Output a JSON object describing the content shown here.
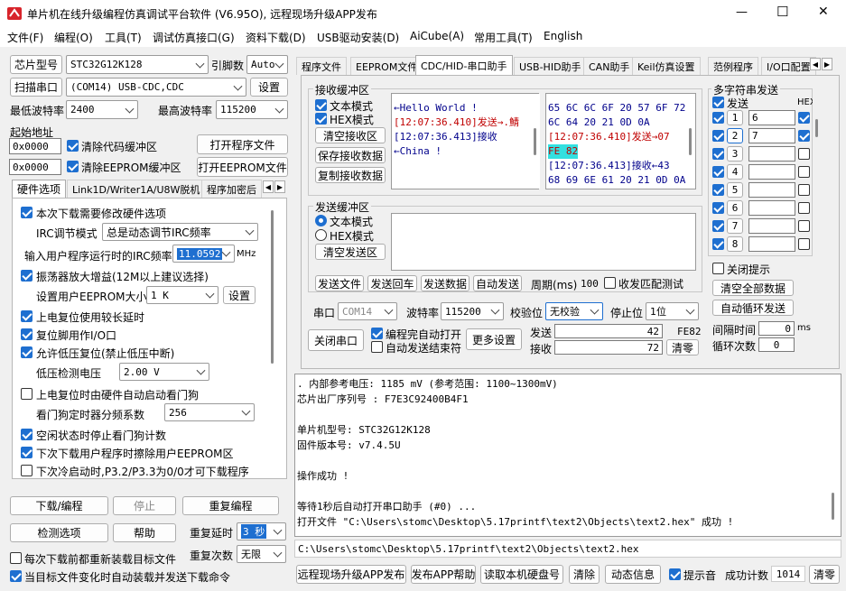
{
  "window": {
    "title": "单片机在线升级编程仿真调试平台软件 (V6.95O), 远程现场升级APP发布",
    "controls": {
      "min": "—",
      "max": "☐",
      "close": "✕"
    }
  },
  "menu": [
    "文件(F)",
    "编程(O)",
    "工具(T)",
    "调试仿真接口(G)",
    "资料下载(D)",
    "USB驱动安装(D)",
    "AiCube(A)",
    "常用工具(T)",
    "English"
  ],
  "left": {
    "chip_label": "芯片型号",
    "chip_value": "STC32G12K128",
    "pin_label": "引脚数",
    "pin_value": "Auto",
    "scan_btn": "扫描串口",
    "port_value": "(COM14) USB-CDC,CDC",
    "settings_btn": "设置",
    "min_baud_label": "最低波特率",
    "min_baud_value": "2400",
    "max_baud_label": "最高波特率",
    "max_baud_value": "115200",
    "start_addr_label": "起始地址",
    "addr1": "0x0000",
    "clear_code_label": "清除代码缓冲区",
    "open_prog_btn": "打开程序文件",
    "addr2": "0x0000",
    "clear_eeprom_label": "清除EEPROM缓冲区",
    "open_eeprom_btn": "打开EEPROM文件",
    "tabs": [
      "硬件选项",
      "Link1D/Writer1A/U8W脱机",
      "程序加密后"
    ],
    "hw": {
      "modify_hw": "本次下载需要修改硬件选项",
      "irc_mode_label": "IRC调节模式",
      "irc_mode_value": "总是动态调节IRC频率",
      "irc_freq_label": "输入用户程序运行时的IRC频率",
      "irc_freq_value": "11.0592",
      "irc_unit": "MHz",
      "osc_gain": "振荡器放大增益(12M以上建议选择)",
      "eeprom_size_label": "设置用户EEPROM大小",
      "eeprom_size_value": "1   K",
      "eeprom_set_btn": "设置",
      "long_reset": "上电复位使用较长延时",
      "reset_pin": "复位脚用作I/O口",
      "lvd_reset": "允许低压复位(禁止低压中断)",
      "lvd_label": "低压检测电压",
      "lvd_value": "2.00 V",
      "wdt_auto": "上电复位时由硬件自动启动看门狗",
      "wdt_div_label": "看门狗定时器分频系数",
      "wdt_div_value": "256",
      "idle_wdt": "空闲状态时停止看门狗计数",
      "erase_eeprom": "下次下载用户程序时擦除用户EEPROM区",
      "cold_boot": "下次冷启动时,P3.2/P3.3为0/0才可下载程序"
    },
    "download_btn": "下载/编程",
    "stop_btn": "停止",
    "reprog_btn": "重复编程",
    "detect_btn": "检测选项",
    "help_btn": "帮助",
    "repeat_delay_label": "重复延时",
    "repeat_delay_value": "3 秒",
    "repeat_count_label": "重复次数",
    "repeat_count_value": "无限",
    "reload_label": "每次下载前都重新装载目标文件",
    "auto_send_label": "当目标文件变化时自动装载并发送下载命令"
  },
  "right_tabs": [
    "程序文件",
    "EEPROM文件",
    "CDC/HID-串口助手",
    "USB-HID助手",
    "CAN助手",
    "Keil仿真设置",
    "范例程序",
    "I/O口配置"
  ],
  "serial": {
    "recv_title": "接收缓冲区",
    "text_mode": "文本模式",
    "hex_mode": "HEX模式",
    "clear_recv_btn": "清空接收区",
    "save_recv_btn": "保存接收数据",
    "copy_recv_btn": "复制接收数据",
    "recv_text": [
      {
        "t": "←Hello World !",
        "c": "#00008b"
      },
      {
        "t": "",
        "c": "#000"
      },
      {
        "t": "[12:07:36.410]发送→.鯖",
        "c": "#c00000"
      },
      {
        "t": "[12:07:36.413]接收",
        "c": "#00008b"
      },
      {
        "t": "←China !",
        "c": "#00008b"
      }
    ],
    "recv_hex": [
      {
        "t": "65 6C 6C 6F 20 57 6F 72",
        "c": "#00008b",
        "hl": false
      },
      {
        "t": "6C 64 20 21 0D 0A",
        "c": "#00008b",
        "hl": false
      },
      {
        "t": "[12:07:36.410]发送→07",
        "c": "#c00000",
        "hl": false
      },
      {
        "t": "FE 82",
        "c": "#c00000",
        "hl": true
      },
      {
        "t": "[12:07:36.413]接收←43",
        "c": "#00008b",
        "hl": false
      },
      {
        "t": "68 69 6E 61 20 21 0D 0A",
        "c": "#00008b",
        "hl": false
      }
    ],
    "send_title": "发送缓冲区",
    "clear_send_btn": "清空发送区",
    "send_file_btn": "发送文件",
    "send_enter_btn": "发送回车",
    "send_data_btn": "发送数据",
    "auto_send_btn": "自动发送",
    "period_label": "周期(ms)",
    "period_value": "100",
    "match_label": "收发匹配测试",
    "port_label": "串口",
    "port_value": "COM14",
    "baud_label": "波特率",
    "baud_value": "115200",
    "parity_label": "校验位",
    "parity_value": "无校验",
    "stop_label": "停止位",
    "stop_value": "1位",
    "close_port_btn": "关闭串口",
    "auto_open_label": "编程完自动打开",
    "auto_end_label": "自动发送结束符",
    "more_btn": "更多设置",
    "send_count_label": "发送",
    "send_count": "42",
    "send_last": "FE82",
    "recv_count_label": "接收",
    "recv_count": "72",
    "clear_count_btn": "清零"
  },
  "multi": {
    "title": "多字符串发送",
    "send_col": "发送",
    "hex_col": "HEX",
    "rows": [
      {
        "n": "1",
        "v": "6",
        "hex": true
      },
      {
        "n": "2",
        "v": "7",
        "hex": true
      },
      {
        "n": "3",
        "v": "",
        "hex": false
      },
      {
        "n": "4",
        "v": "",
        "hex": false
      },
      {
        "n": "5",
        "v": "",
        "hex": false
      },
      {
        "n": "6",
        "v": "",
        "hex": false
      },
      {
        "n": "7",
        "v": "",
        "hex": false
      },
      {
        "n": "8",
        "v": "",
        "hex": false
      }
    ],
    "close_hint": "关闭提示",
    "clear_all_btn": "清空全部数据",
    "auto_loop_btn": "自动循环发送",
    "interval_label": "间隔时间",
    "interval_value": "0",
    "interval_unit": "ms",
    "loop_label": "循环次数",
    "loop_value": "0"
  },
  "log": {
    "lines": [
      "  . 内部参考电压: 1185 mV (参考范围: 1100~1300mV)",
      "芯片出厂序列号 : F7E3C92400B4F1",
      "",
      "  单片机型号: STC32G12K128",
      "  固件版本号: v7.4.5U",
      "",
      "操作成功 !",
      "",
      "等待1秒后自动打开串口助手 (#0) ...",
      "打开文件 \"C:\\Users\\stomc\\Desktop\\5.17printf\\text2\\Objects\\text2.hex\" 成功 !"
    ],
    "path": "C:\\Users\\stomc\\Desktop\\5.17printf\\text2\\Objects\\text2.hex"
  },
  "bottom": {
    "publish_btn": "远程现场升级APP发布",
    "publish_help_btn": "发布APP帮助",
    "read_disk_btn": "读取本机硬盘号",
    "clear_btn": "清除",
    "anim_btn": "动态信息",
    "beep_label": "提示音",
    "success_label": "成功计数",
    "success_value": "1014",
    "clear_zero_btn": "清零"
  }
}
